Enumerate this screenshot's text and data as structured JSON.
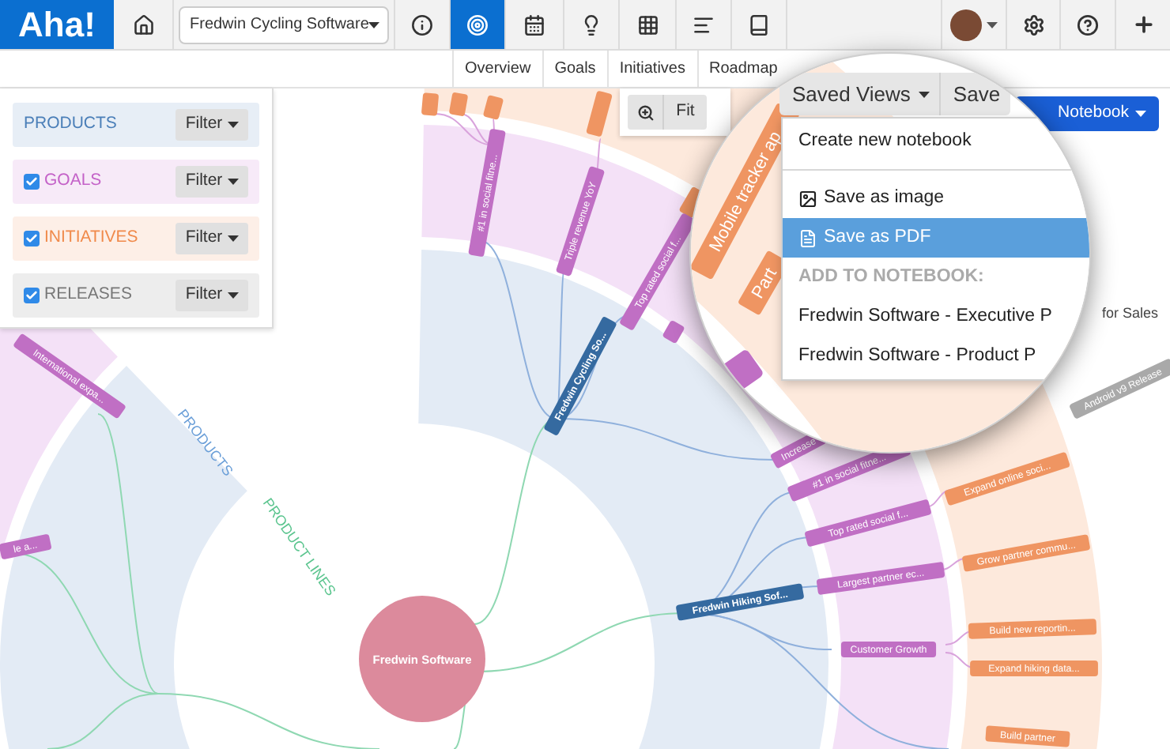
{
  "nav": {
    "logo": "Aha!",
    "product_select": "Fredwin Cycling Software",
    "icons": [
      {
        "kind": "home",
        "selected": false
      },
      {
        "kind": "info",
        "selected": false
      },
      {
        "kind": "target",
        "selected": true
      },
      {
        "kind": "calendar",
        "selected": false
      },
      {
        "kind": "bulb",
        "selected": false
      },
      {
        "kind": "grid",
        "selected": false
      },
      {
        "kind": "lines",
        "selected": false
      },
      {
        "kind": "book",
        "selected": false
      }
    ],
    "right_icons": [
      {
        "kind": "avatar"
      },
      {
        "kind": "settings"
      },
      {
        "kind": "help"
      },
      {
        "kind": "plus"
      }
    ]
  },
  "tabs": [
    {
      "label": "Overview"
    },
    {
      "label": "Goals"
    },
    {
      "label": "Initiatives"
    },
    {
      "label": "Roadmap"
    }
  ],
  "filters": [
    {
      "label": "PRODUCTS",
      "color": "#4b7fb8",
      "button": "Filter"
    },
    {
      "label": "GOALS",
      "color": "#c462c8",
      "checked": true,
      "button": "Filter"
    },
    {
      "label": "INITIATIVES",
      "color": "#f08a4b",
      "checked": true,
      "button": "Filter"
    },
    {
      "label": "RELEASES",
      "color": "#777777",
      "checked": true,
      "button": "Filter"
    }
  ],
  "toolbar": {
    "fit": "Fit"
  },
  "notebook_button": "Notebook",
  "side_note": "for Sales",
  "diagram": {
    "center": "Fredwin Software",
    "ring_labels": [
      {
        "kind": "products",
        "text": "PRODUCTS"
      },
      {
        "kind": "lines",
        "text": "PRODUCT LINES"
      }
    ],
    "nodes": [
      {
        "kind": "product",
        "text": "Fredwin Cycling So..."
      },
      {
        "kind": "product",
        "text": "Fredwin Hiking Sof..."
      },
      {
        "kind": "goal",
        "text": "#1 in social fitne..."
      },
      {
        "kind": "goal",
        "text": "Triple revenue YoY"
      },
      {
        "kind": "goal",
        "text": "Top rated social f..."
      },
      {
        "kind": "goal",
        "text": "Increase"
      },
      {
        "kind": "goal",
        "text": "#1 in social fitne..."
      },
      {
        "kind": "goal",
        "text": "Top rated social f..."
      },
      {
        "kind": "goal",
        "text": "Largest partner ec..."
      },
      {
        "kind": "goal",
        "text": "Customer Growth"
      },
      {
        "kind": "goal",
        "text": "International expa..."
      },
      {
        "kind": "goal",
        "text": "le a..."
      },
      {
        "kind": "initiative",
        "text": "Expand online soci..."
      },
      {
        "kind": "initiative",
        "text": "Grow partner commu..."
      },
      {
        "kind": "initiative",
        "text": "Build new reportin..."
      },
      {
        "kind": "initiative",
        "text": "Expand hiking data..."
      },
      {
        "kind": "initiative",
        "text": "Build partner"
      },
      {
        "kind": "release",
        "text": "Android v9 Release"
      }
    ]
  },
  "magnifier": {
    "saved_views": "Saved Views",
    "save": "Save",
    "tags": [
      {
        "kind": "initiative",
        "text": "Mobile tracker ap"
      },
      {
        "kind": "initiative",
        "text": "Part"
      }
    ],
    "menu": [
      {
        "kind": "item",
        "label": "Create new notebook",
        "selected": false
      },
      {
        "kind": "image",
        "label": "Save as image",
        "selected": false
      },
      {
        "kind": "pdf",
        "label": "Save as PDF",
        "selected": true
      },
      {
        "kind": "header",
        "label": "ADD TO NOTEBOOK:"
      },
      {
        "kind": "item",
        "label": "Fredwin Software - Executive P",
        "selected": false
      },
      {
        "kind": "item",
        "label": "Fredwin Software - Product P",
        "selected": false
      }
    ]
  }
}
